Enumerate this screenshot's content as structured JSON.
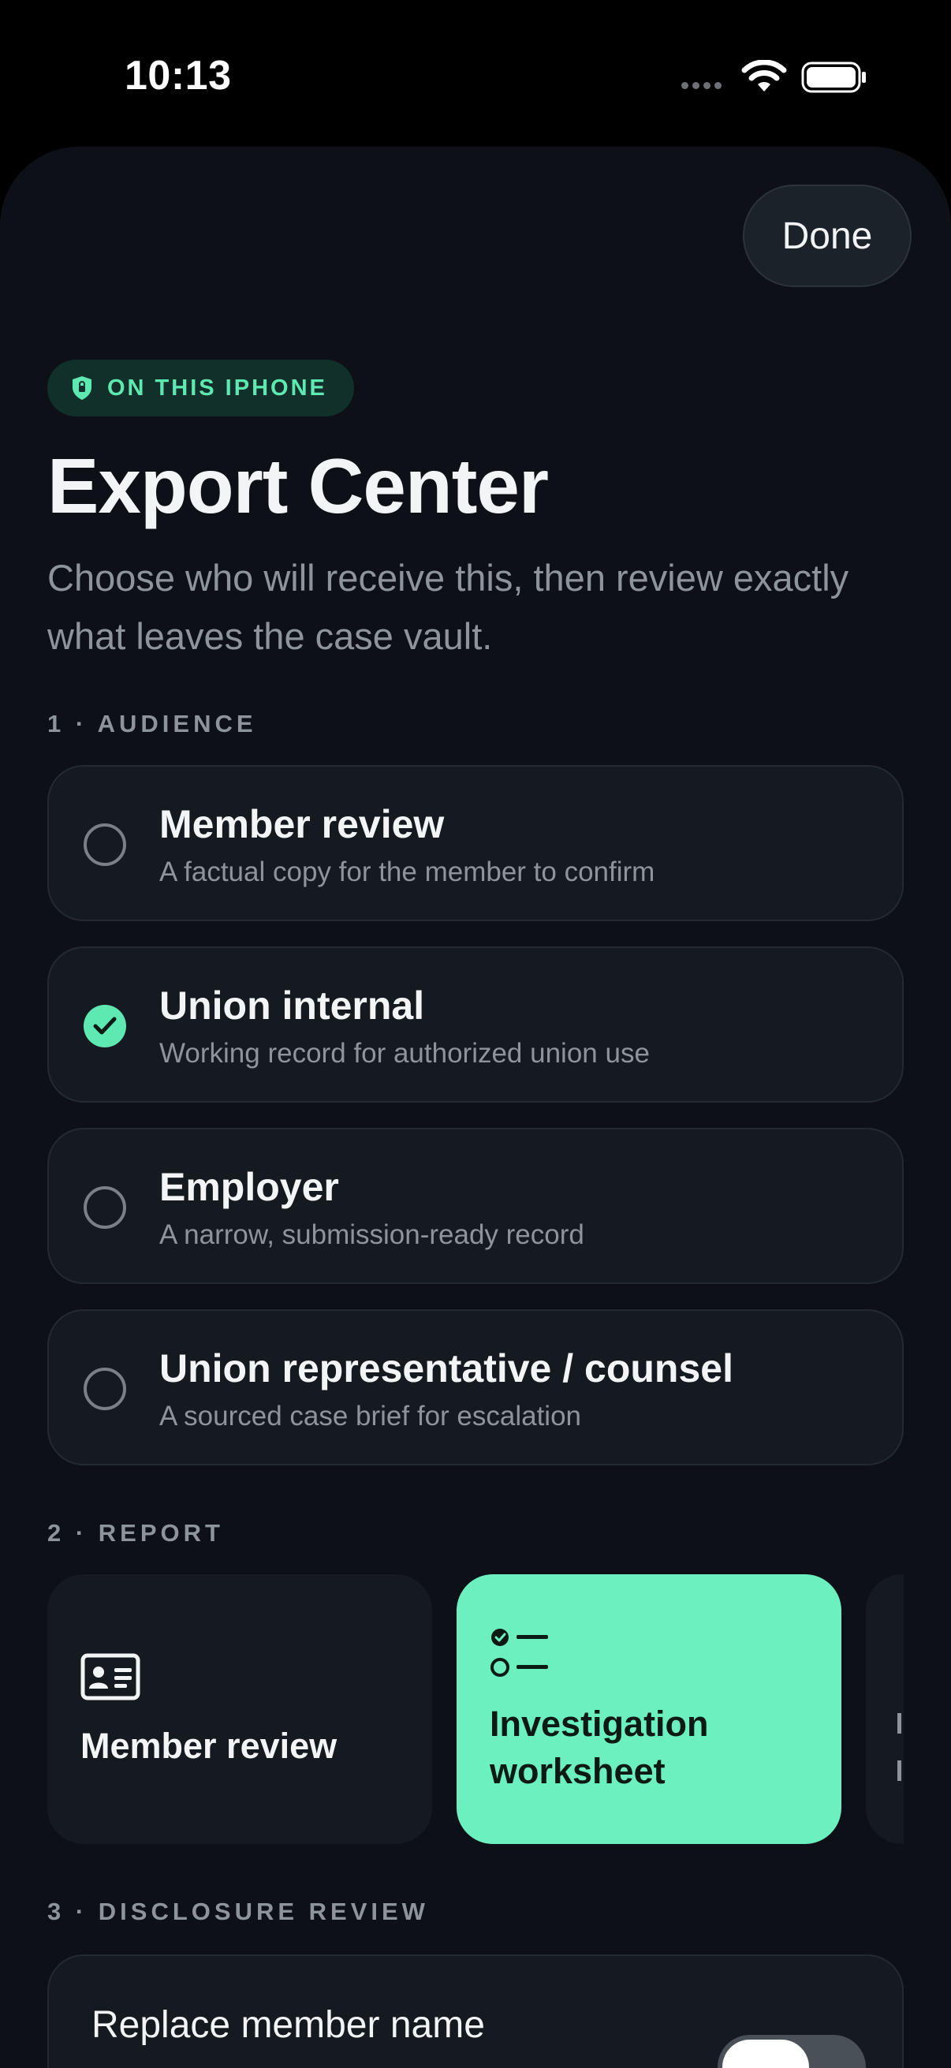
{
  "status_bar": {
    "time": "10:13"
  },
  "header": {
    "done_label": "Done",
    "badge_label": "ON THIS IPHONE",
    "title": "Export Center",
    "subtitle": "Choose who will receive this, then review exactly what leaves the case vault."
  },
  "audience": {
    "section_label": "1 · AUDIENCE",
    "options": [
      {
        "title": "Member review",
        "description": "A factual copy for the member to confirm",
        "selected": false
      },
      {
        "title": "Union internal",
        "description": "Working record for authorized union use",
        "selected": true
      },
      {
        "title": "Employer",
        "description": "A narrow, submission-ready record",
        "selected": false
      },
      {
        "title": "Union representative / counsel",
        "description": "A sourced case brief for escalation",
        "selected": false
      }
    ]
  },
  "report": {
    "section_label": "2 · REPORT",
    "cards": [
      {
        "label": "Member review",
        "icon": "id-card-icon",
        "selected": false
      },
      {
        "label": "Investigation worksheet",
        "icon": "checklist-icon",
        "selected": true
      }
    ]
  },
  "disclosure": {
    "section_label": "3 · DISCLOSURE REVIEW",
    "items": [
      {
        "label": "Replace member name",
        "enabled": false
      }
    ]
  },
  "colors": {
    "accent": "#5de9b1",
    "selected_card": "#6cf0bf",
    "sheet_background": "#0d1117",
    "card_background": "#151a20"
  }
}
